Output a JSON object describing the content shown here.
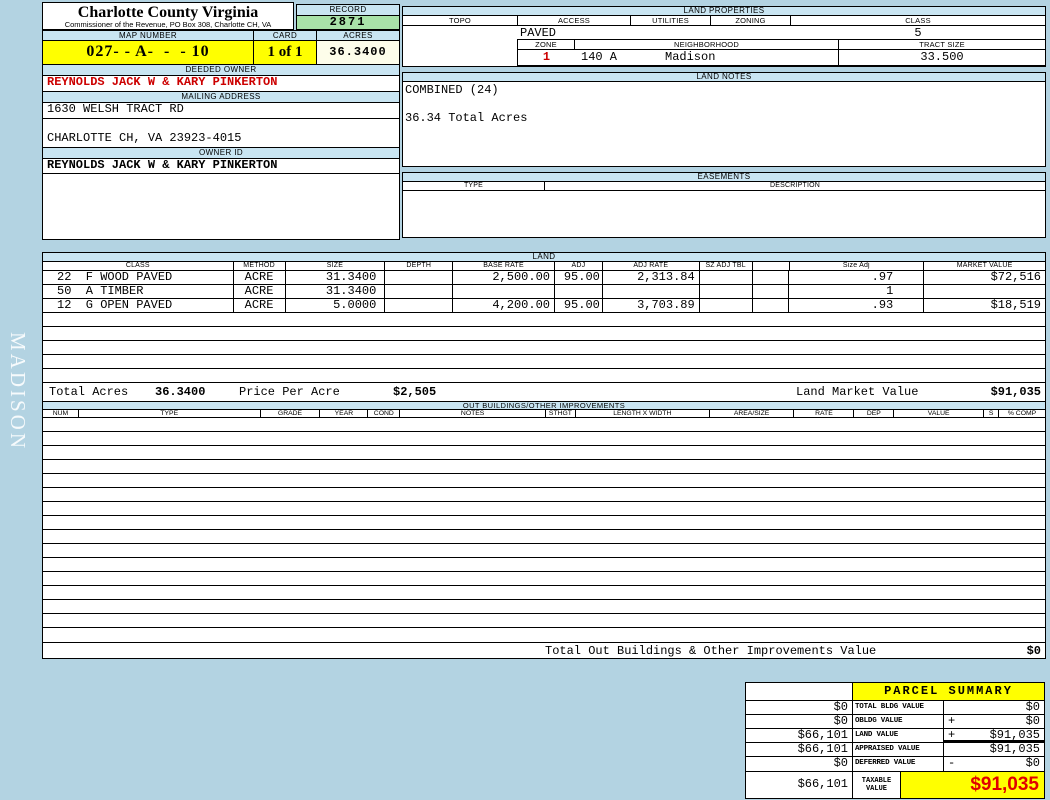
{
  "colors": {
    "page_bg": "#b3d3e2",
    "section_bar": "#c9e5f2",
    "record_green": "#a8e2a8",
    "highlight_yellow": "#ffff00",
    "acres_ivory": "#fdfdea",
    "owner_red": "#cc0000",
    "taxable_red": "#e00000",
    "row_stripe": "#eef0f8"
  },
  "header": {
    "county_title": "Charlotte County Virginia",
    "county_subtitle": "Commissioner of the Revenue, PO Box 308, Charlotte CH, VA",
    "record_label": "RECORD",
    "record_value": "2871",
    "map_number_label": "MAP NUMBER",
    "map_number_value": "027- - A-  -  - 10",
    "card_label": "CARD",
    "card_value": "1 of 1",
    "acres_label": "ACRES",
    "acres_value": "36.3400",
    "sidebar_label": "MADISON"
  },
  "owner": {
    "deeded_owner_label": "DEEDED OWNER",
    "deeded_owner": "REYNOLDS JACK W & KARY PINKERTON",
    "mailing_address_label": "MAILING ADDRESS",
    "address_line1": "1630 WELSH TRACT RD",
    "address_line2": "CHARLOTTE CH, VA 23923-4015",
    "owner_id_label": "OWNER ID",
    "owner_id": "REYNOLDS JACK W & KARY PINKERTON"
  },
  "land_properties": {
    "title": "LAND PROPERTIES",
    "columns": [
      "TOPO",
      "ACCESS",
      "UTILITIES",
      "ZONING",
      "CLASS"
    ],
    "access_value": "PAVED",
    "class_value": "5",
    "zone_label": "ZONE",
    "zone_value": "1",
    "neighborhood_label": "NEIGHBORHOOD",
    "neighborhood_code": "140 A",
    "neighborhood_name": "Madison",
    "tract_size_label": "TRACT SIZE",
    "tract_size_value": "33.500"
  },
  "land_notes": {
    "title": "LAND NOTES",
    "line1": "COMBINED (24)",
    "line2": "36.34 Total Acres"
  },
  "easements": {
    "title": "EASEMENTS",
    "type_label": "TYPE",
    "description_label": "DESCRIPTION"
  },
  "land": {
    "title": "LAND",
    "columns": [
      "CLASS",
      "METHOD",
      "SIZE",
      "DEPTH",
      "BASE RATE",
      "ADJ",
      "ADJ RATE",
      "SZ ADJ TBL",
      "",
      "Size Adj",
      "MARKET VALUE"
    ],
    "rows": [
      {
        "class": "22  F WOOD PAVED",
        "method": "ACRE",
        "size": "31.3400",
        "depth": "",
        "base_rate": "2,500.00",
        "adj": "95.00",
        "adj_rate": "2,313.84",
        "sz_adj_tbl": "",
        "size_adj": ".97",
        "market_value": "$72,516"
      },
      {
        "class": "50  A TIMBER",
        "method": "ACRE",
        "size": "31.3400",
        "depth": "",
        "base_rate": "",
        "adj": "",
        "adj_rate": "",
        "sz_adj_tbl": "",
        "size_adj": "1",
        "market_value": ""
      },
      {
        "class": "12  G OPEN PAVED",
        "method": "ACRE",
        "size": "5.0000",
        "depth": "",
        "base_rate": "4,200.00",
        "adj": "95.00",
        "adj_rate": "3,703.89",
        "sz_adj_tbl": "",
        "size_adj": ".93",
        "market_value": "$18,519"
      }
    ],
    "totals": {
      "total_acres_label": "Total Acres",
      "total_acres": "36.3400",
      "price_per_acre_label": "Price Per Acre",
      "price_per_acre": "$2,505",
      "land_market_value_label": "Land Market Value",
      "land_market_value": "$91,035"
    }
  },
  "out_buildings": {
    "title": "OUT BUILDINGS/OTHER IMPROVEMENTS",
    "columns": [
      "NUM",
      "TYPE",
      "GRADE",
      "YEAR",
      "COND",
      "NOTES",
      "STHGT",
      "LENGTH X WIDTH",
      "AREA/SIZE",
      "RATE",
      "DEP",
      "VALUE",
      "S",
      "% COMP"
    ],
    "total_label": "Total Out Buildings & Other Improvements Value",
    "total_value": "$0"
  },
  "parcel_summary": {
    "title": "PARCEL SUMMARY",
    "rows": [
      {
        "left": "$0",
        "label": "TOTAL BLDG VALUE",
        "op": "",
        "value": "$0"
      },
      {
        "left": "$0",
        "label": "OBLDG VALUE",
        "op": "+",
        "value": "$0"
      },
      {
        "left": "$66,101",
        "label": "LAND VALUE",
        "op": "+",
        "value": "$91,035"
      },
      {
        "left": "$66,101",
        "label": "APPRAISED VALUE",
        "op": "",
        "value": "$91,035"
      },
      {
        "left": "$0",
        "label": "DEFERRED VALUE",
        "op": "-",
        "value": "$0"
      }
    ],
    "taxable": {
      "left": "$66,101",
      "label": "TAXABLE VALUE",
      "value": "$91,035"
    }
  }
}
